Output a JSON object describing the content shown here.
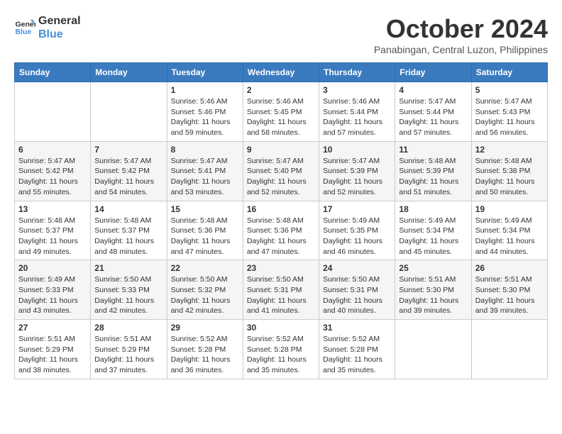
{
  "header": {
    "logo_line1": "General",
    "logo_line2": "Blue",
    "month": "October 2024",
    "location": "Panabingan, Central Luzon, Philippines"
  },
  "weekdays": [
    "Sunday",
    "Monday",
    "Tuesday",
    "Wednesday",
    "Thursday",
    "Friday",
    "Saturday"
  ],
  "weeks": [
    [
      {
        "day": "",
        "info": ""
      },
      {
        "day": "",
        "info": ""
      },
      {
        "day": "1",
        "info": "Sunrise: 5:46 AM\nSunset: 5:46 PM\nDaylight: 11 hours\nand 59 minutes."
      },
      {
        "day": "2",
        "info": "Sunrise: 5:46 AM\nSunset: 5:45 PM\nDaylight: 11 hours\nand 58 minutes."
      },
      {
        "day": "3",
        "info": "Sunrise: 5:46 AM\nSunset: 5:44 PM\nDaylight: 11 hours\nand 57 minutes."
      },
      {
        "day": "4",
        "info": "Sunrise: 5:47 AM\nSunset: 5:44 PM\nDaylight: 11 hours\nand 57 minutes."
      },
      {
        "day": "5",
        "info": "Sunrise: 5:47 AM\nSunset: 5:43 PM\nDaylight: 11 hours\nand 56 minutes."
      }
    ],
    [
      {
        "day": "6",
        "info": "Sunrise: 5:47 AM\nSunset: 5:42 PM\nDaylight: 11 hours\nand 55 minutes."
      },
      {
        "day": "7",
        "info": "Sunrise: 5:47 AM\nSunset: 5:42 PM\nDaylight: 11 hours\nand 54 minutes."
      },
      {
        "day": "8",
        "info": "Sunrise: 5:47 AM\nSunset: 5:41 PM\nDaylight: 11 hours\nand 53 minutes."
      },
      {
        "day": "9",
        "info": "Sunrise: 5:47 AM\nSunset: 5:40 PM\nDaylight: 11 hours\nand 52 minutes."
      },
      {
        "day": "10",
        "info": "Sunrise: 5:47 AM\nSunset: 5:39 PM\nDaylight: 11 hours\nand 52 minutes."
      },
      {
        "day": "11",
        "info": "Sunrise: 5:48 AM\nSunset: 5:39 PM\nDaylight: 11 hours\nand 51 minutes."
      },
      {
        "day": "12",
        "info": "Sunrise: 5:48 AM\nSunset: 5:38 PM\nDaylight: 11 hours\nand 50 minutes."
      }
    ],
    [
      {
        "day": "13",
        "info": "Sunrise: 5:48 AM\nSunset: 5:37 PM\nDaylight: 11 hours\nand 49 minutes."
      },
      {
        "day": "14",
        "info": "Sunrise: 5:48 AM\nSunset: 5:37 PM\nDaylight: 11 hours\nand 48 minutes."
      },
      {
        "day": "15",
        "info": "Sunrise: 5:48 AM\nSunset: 5:36 PM\nDaylight: 11 hours\nand 47 minutes."
      },
      {
        "day": "16",
        "info": "Sunrise: 5:48 AM\nSunset: 5:36 PM\nDaylight: 11 hours\nand 47 minutes."
      },
      {
        "day": "17",
        "info": "Sunrise: 5:49 AM\nSunset: 5:35 PM\nDaylight: 11 hours\nand 46 minutes."
      },
      {
        "day": "18",
        "info": "Sunrise: 5:49 AM\nSunset: 5:34 PM\nDaylight: 11 hours\nand 45 minutes."
      },
      {
        "day": "19",
        "info": "Sunrise: 5:49 AM\nSunset: 5:34 PM\nDaylight: 11 hours\nand 44 minutes."
      }
    ],
    [
      {
        "day": "20",
        "info": "Sunrise: 5:49 AM\nSunset: 5:33 PM\nDaylight: 11 hours\nand 43 minutes."
      },
      {
        "day": "21",
        "info": "Sunrise: 5:50 AM\nSunset: 5:33 PM\nDaylight: 11 hours\nand 42 minutes."
      },
      {
        "day": "22",
        "info": "Sunrise: 5:50 AM\nSunset: 5:32 PM\nDaylight: 11 hours\nand 42 minutes."
      },
      {
        "day": "23",
        "info": "Sunrise: 5:50 AM\nSunset: 5:31 PM\nDaylight: 11 hours\nand 41 minutes."
      },
      {
        "day": "24",
        "info": "Sunrise: 5:50 AM\nSunset: 5:31 PM\nDaylight: 11 hours\nand 40 minutes."
      },
      {
        "day": "25",
        "info": "Sunrise: 5:51 AM\nSunset: 5:30 PM\nDaylight: 11 hours\nand 39 minutes."
      },
      {
        "day": "26",
        "info": "Sunrise: 5:51 AM\nSunset: 5:30 PM\nDaylight: 11 hours\nand 39 minutes."
      }
    ],
    [
      {
        "day": "27",
        "info": "Sunrise: 5:51 AM\nSunset: 5:29 PM\nDaylight: 11 hours\nand 38 minutes."
      },
      {
        "day": "28",
        "info": "Sunrise: 5:51 AM\nSunset: 5:29 PM\nDaylight: 11 hours\nand 37 minutes."
      },
      {
        "day": "29",
        "info": "Sunrise: 5:52 AM\nSunset: 5:28 PM\nDaylight: 11 hours\nand 36 minutes."
      },
      {
        "day": "30",
        "info": "Sunrise: 5:52 AM\nSunset: 5:28 PM\nDaylight: 11 hours\nand 35 minutes."
      },
      {
        "day": "31",
        "info": "Sunrise: 5:52 AM\nSunset: 5:28 PM\nDaylight: 11 hours\nand 35 minutes."
      },
      {
        "day": "",
        "info": ""
      },
      {
        "day": "",
        "info": ""
      }
    ]
  ]
}
